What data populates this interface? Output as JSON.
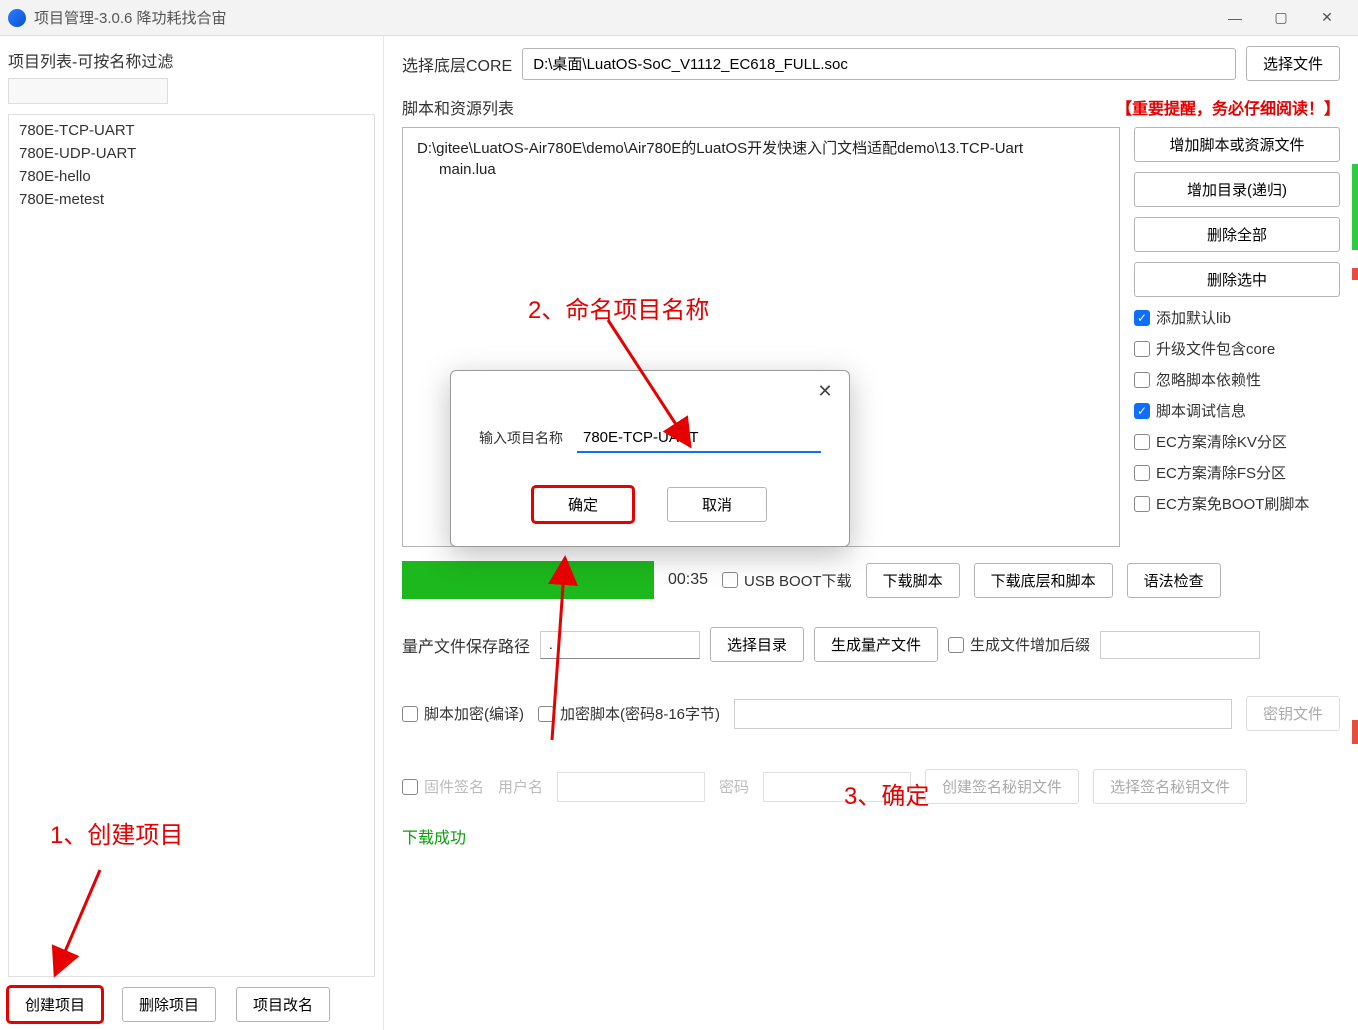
{
  "window": {
    "title": "项目管理-3.0.6 降功耗找合宙"
  },
  "sidebar": {
    "title": "项目列表-可按名称过滤",
    "filter_value": "",
    "projects": [
      "780E-TCP-UART",
      "780E-UDP-UART",
      "780E-hello",
      "780E-metest"
    ],
    "buttons": {
      "create": "创建项目",
      "delete": "删除项目",
      "rename": "项目改名"
    }
  },
  "annotations": {
    "a1": "1、创建项目",
    "a2": "2、命名项目名称",
    "a3": "3、确定"
  },
  "core": {
    "label": "选择底层CORE",
    "path": "D:\\桌面\\LuatOS-SoC_V1112_EC618_FULL.soc",
    "choose_btn": "选择文件"
  },
  "scripts": {
    "header": "脚本和资源列表",
    "warning": "【重要提醒，务必仔细阅读！】",
    "tree_root": "D:\\gitee\\LuatOS-Air780E\\demo\\Air780E的LuatOS开发快速入门文档适配demo\\13.TCP-Uart",
    "tree_child": "main.lua"
  },
  "right_buttons": {
    "add_file": "增加脚本或资源文件",
    "add_dir": "增加目录(递归)",
    "del_all": "删除全部",
    "del_sel": "删除选中"
  },
  "checks": [
    {
      "label": "添加默认lib",
      "checked": true
    },
    {
      "label": "升级文件包含core",
      "checked": false
    },
    {
      "label": "忽略脚本依赖性",
      "checked": false
    },
    {
      "label": "脚本调试信息",
      "checked": true
    },
    {
      "label": "EC方案清除KV分区",
      "checked": false
    },
    {
      "label": "EC方案清除FS分区",
      "checked": false
    },
    {
      "label": "EC方案免BOOT刷脚本",
      "checked": false
    }
  ],
  "progress": {
    "time": "00:35",
    "usb_boot": "USB BOOT下载",
    "download_script": "下载脚本",
    "download_core": "下载底层和脚本",
    "syntax": "语法检查"
  },
  "massprod": {
    "label": "量产文件保存路径",
    "path": ".",
    "choose_dir": "选择目录",
    "gen": "生成量产文件",
    "suffix_chk": "生成文件增加后缀",
    "suffix_val": ""
  },
  "encrypt": {
    "chk1": "脚本加密(编译)",
    "chk2": "加密脚本(密码8-16字节)",
    "pwd": "",
    "keyfile_btn": "密钥文件"
  },
  "sign": {
    "chk": "固件签名",
    "user_lbl": "用户名",
    "user": "",
    "pass_lbl": "密码",
    "pass": "",
    "create_key": "创建签名秘钥文件",
    "choose_key": "选择签名秘钥文件"
  },
  "status": "下载成功",
  "dialog": {
    "label": "输入项目名称",
    "value": "780E-TCP-UART",
    "ok": "确定",
    "cancel": "取消"
  }
}
